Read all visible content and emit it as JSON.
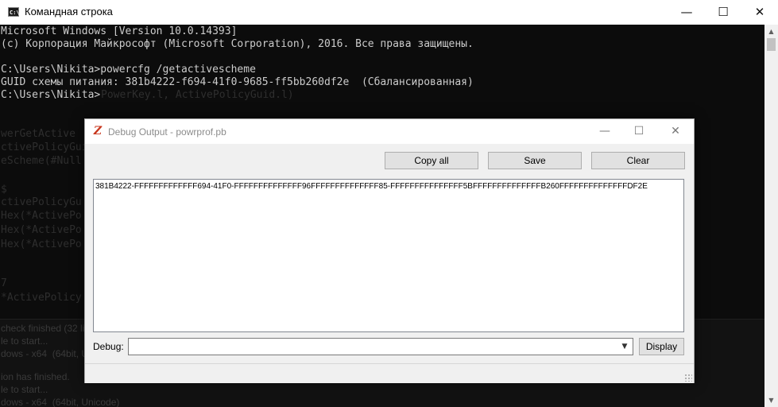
{
  "cmd": {
    "title": "Командная строка",
    "icon_text": "C:\\",
    "lines": [
      "Microsoft Windows [Version 10.0.14393]",
      "(c) Корпорация Майкрософт (Microsoft Corporation), 2016. Все права защищены.",
      "",
      "C:\\Users\\Nikita>powercfg /getactivescheme",
      "GUID схемы питания: 381b4222-f694-41f0-9685-ff5bb260df2e  (Сбалансированная)",
      "C:\\Users\\Nikita>"
    ],
    "ghost_code": [
      "PowerKey.l, ActivePolicyGuid.l)",
      "werGetActive",
      "ctivePolicyGui",
      "eScheme(#Null",
      "$",
      "ctivePolicyGu",
      "Hex(*ActivePo",
      "Hex(*ActivePo",
      "Hex(*ActivePo",
      "7",
      "*ActivePolicy"
    ],
    "ghost_panel": [
      "check finished (32 li",
      "le to start...",
      "dows - x64  (64bit, U",
      "ion has finished.",
      "le to start...",
      "dows - x64  (64bit, Unicode)"
    ]
  },
  "window_controls": {
    "minimize": "—",
    "maximize": "☐",
    "close": "✕"
  },
  "dialog": {
    "title": "Debug Output - powrprof.pb",
    "icon_glyph": "Z",
    "buttons": {
      "copy_all": "Copy all",
      "save": "Save",
      "clear": "Clear",
      "display": "Display"
    },
    "output": "381B4222-FFFFFFFFFFFFF694-41F0-FFFFFFFFFFFFFF96FFFFFFFFFFFFFF85-FFFFFFFFFFFFFFF5BFFFFFFFFFFFFFFB260FFFFFFFFFFFFFFDF2E",
    "debug_label": "Debug:",
    "debug_value": ""
  },
  "colors": {
    "console_bg": "#0c0c0c",
    "console_text": "#cccccc",
    "dialog_bg": "#f0f0f0",
    "button_bg": "#e1e1e1"
  }
}
